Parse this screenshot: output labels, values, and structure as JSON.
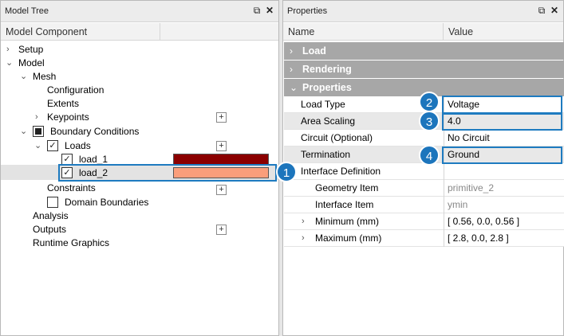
{
  "model_tree": {
    "title": "Model Tree",
    "pin_icon": "⧉",
    "close_icon": "✕",
    "column_header": "Model Component",
    "items": {
      "setup": "Setup",
      "model": "Model",
      "mesh": "Mesh",
      "configuration": "Configuration",
      "extents": "Extents",
      "keypoints": "Keypoints",
      "boundary_conditions": "Boundary Conditions",
      "loads": "Loads",
      "load_1": "load_1",
      "load_2": "load_2",
      "constraints": "Constraints",
      "domain_boundaries": "Domain Boundaries",
      "analysis": "Analysis",
      "outputs": "Outputs",
      "runtime_graphics": "Runtime Graphics"
    },
    "load_1_color": "#8b0000",
    "load_2_color": "#fa9e7b",
    "add_symbol": "+",
    "check_symbol": "✓",
    "collapsed_symbol": "›",
    "expanded_symbol": "⌄"
  },
  "properties": {
    "title": "Properties",
    "pin_icon": "⧉",
    "close_icon": "✕",
    "col_name": "Name",
    "col_value": "Value",
    "sections": {
      "load": "Load",
      "rendering": "Rendering",
      "properties": "Properties"
    },
    "rows": {
      "load_type": {
        "name": "Load Type",
        "value": "Voltage"
      },
      "area_scaling": {
        "name": "Area Scaling",
        "value": "4.0"
      },
      "circuit": {
        "name": "Circuit (Optional)",
        "value": "No Circuit"
      },
      "termination": {
        "name": "Termination",
        "value": "Ground"
      },
      "interface_definition": {
        "name": "Interface Definition",
        "value": ""
      },
      "geometry_item": {
        "name": "Geometry Item",
        "value": "primitive_2"
      },
      "interface_item": {
        "name": "Interface Item",
        "value": "ymin"
      },
      "minimum": {
        "name": "Minimum (mm)",
        "value": "[ 0.56, 0.0, 0.56 ]"
      },
      "maximum": {
        "name": "Maximum (mm)",
        "value": "[ 2.8, 0.0, 2.8 ]"
      }
    }
  },
  "callouts": {
    "one": "1",
    "two": "2",
    "three": "3",
    "four": "4",
    "color": "#1c75bc"
  }
}
